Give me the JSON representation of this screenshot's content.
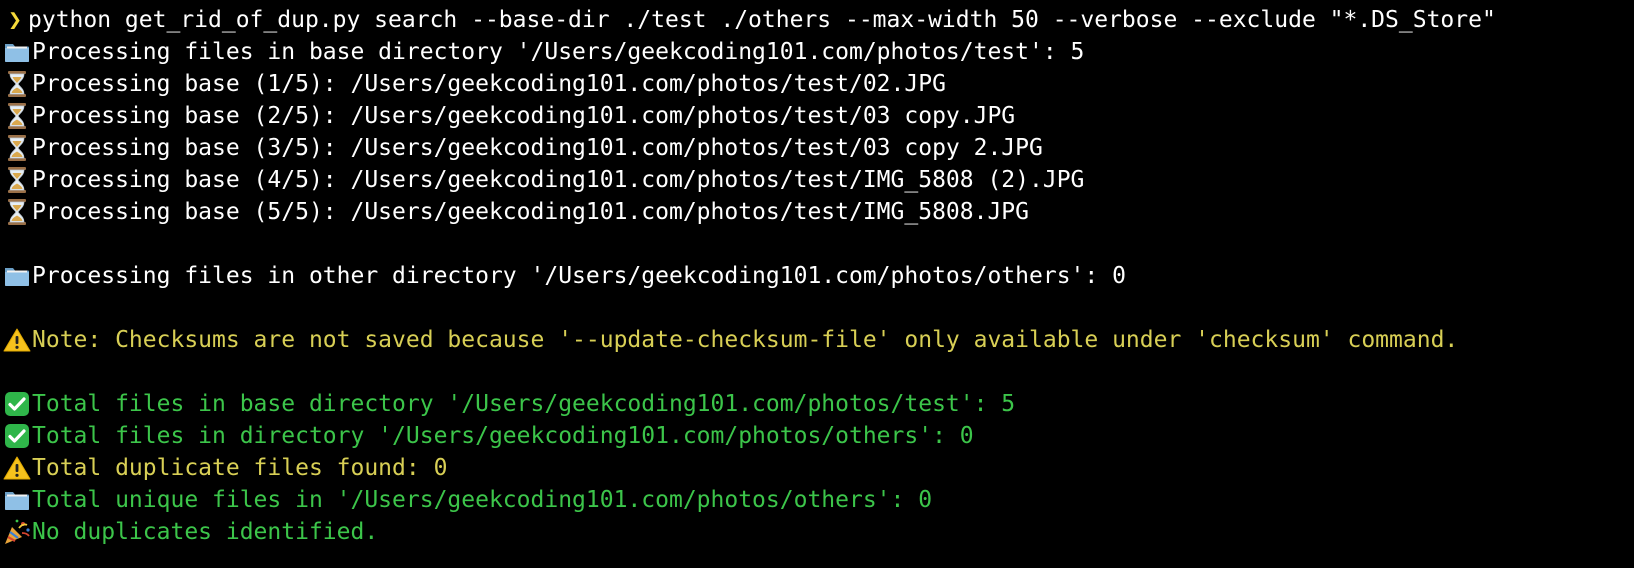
{
  "colors": {
    "background": "#000000",
    "white": "#ffffff",
    "yellow": "#d8cf55",
    "green": "#3cc54a",
    "prompt": "#f5d93a"
  },
  "command": {
    "prompt_icon": "chevron-right-icon",
    "text": "python get_rid_of_dup.py search --base-dir ./test ./others --max-width 50 --verbose --exclude \"*.DS_Store\""
  },
  "lines": [
    {
      "icon": "folder-icon",
      "text": "Processing files in base directory '/Users/geekcoding101.com/photos/test': 5",
      "color": "white"
    },
    {
      "icon": "hourglass-icon",
      "text": "Processing base (1/5): /Users/geekcoding101.com/photos/test/02.JPG",
      "color": "white"
    },
    {
      "icon": "hourglass-icon",
      "text": "Processing base (2/5): /Users/geekcoding101.com/photos/test/03 copy.JPG",
      "color": "white"
    },
    {
      "icon": "hourglass-icon",
      "text": "Processing base (3/5): /Users/geekcoding101.com/photos/test/03 copy 2.JPG",
      "color": "white"
    },
    {
      "icon": "hourglass-icon",
      "text": "Processing base (4/5): /Users/geekcoding101.com/photos/test/IMG_5808 (2).JPG",
      "color": "white"
    },
    {
      "icon": "hourglass-icon",
      "text": "Processing base (5/5): /Users/geekcoding101.com/photos/test/IMG_5808.JPG",
      "color": "white"
    },
    {
      "icon": "",
      "text": "",
      "color": "white"
    },
    {
      "icon": "folder-icon",
      "text": "Processing files in other directory '/Users/geekcoding101.com/photos/others': 0",
      "color": "white"
    },
    {
      "icon": "",
      "text": "",
      "color": "white"
    },
    {
      "icon": "warning-icon",
      "text": "Note: Checksums are not saved because '--update-checksum-file' only available under 'checksum' command.",
      "color": "yellow"
    },
    {
      "icon": "",
      "text": "",
      "color": "white"
    },
    {
      "icon": "check-icon",
      "text": "Total files in base directory '/Users/geekcoding101.com/photos/test': 5",
      "color": "green"
    },
    {
      "icon": "check-icon",
      "text": "Total files in directory '/Users/geekcoding101.com/photos/others': 0",
      "color": "green"
    },
    {
      "icon": "warning-icon",
      "text": "Total duplicate files found: 0",
      "color": "yellow"
    },
    {
      "icon": "folder-icon",
      "text": "Total unique files in '/Users/geekcoding101.com/photos/others': 0",
      "color": "green"
    },
    {
      "icon": "party-popper-icon",
      "text": "No duplicates identified.",
      "color": "green"
    }
  ]
}
